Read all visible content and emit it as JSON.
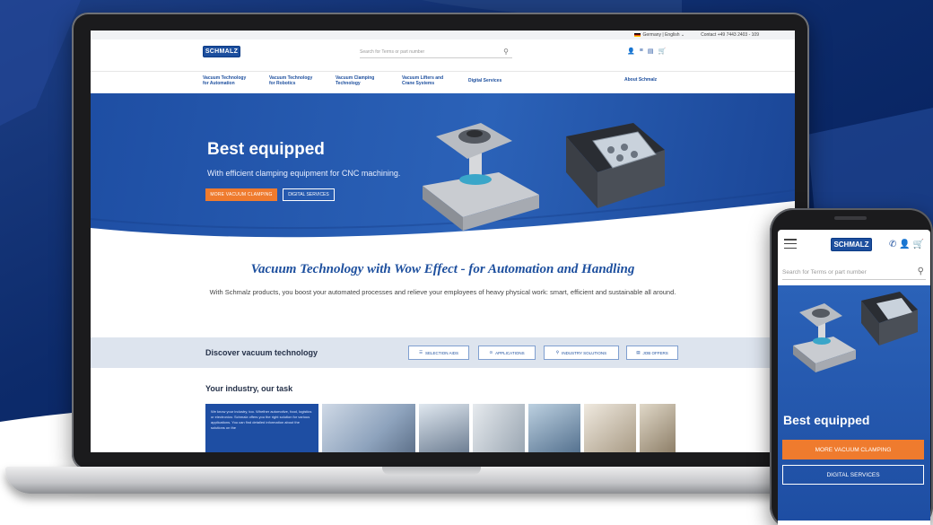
{
  "laptop": {
    "topbar": {
      "locale": "Germany | English",
      "contact": "Contact +49 7443 2403 - 109"
    },
    "header": {
      "logo": "SCHMALZ",
      "search_placeholder": "Search for Terms or part number"
    },
    "nav": [
      {
        "label": "Vacuum Technology for Automation"
      },
      {
        "label": "Vacuum Technology for Robotics"
      },
      {
        "label": "Vacuum Clamping Technology"
      },
      {
        "label": "Vacuum Lifters and Crane Systems"
      },
      {
        "label": "Digital Services"
      }
    ],
    "nav_about": "About Schmalz",
    "hero": {
      "title": "Best equipped",
      "subtitle": "With efficient clamping equipment for CNC machining.",
      "primary_button": "MORE VACUUM CLAMPING",
      "secondary_button": "DIGITAL SERVICES"
    },
    "section": {
      "title": "Vacuum Technology with Wow Effect - for Automation and Handling",
      "text": "With Schmalz products, you boost your automated processes and relieve your employees of heavy physical work: smart, efficient and sustainable all around."
    },
    "discover": {
      "label": "Discover vacuum technology",
      "buttons": [
        {
          "label": "SELECTION AIDS",
          "icon": "sliders-icon"
        },
        {
          "label": "APPLICATIONS",
          "icon": "play-circle-icon"
        },
        {
          "label": "INDUSTRY SOLUTIONS",
          "icon": "search-icon"
        },
        {
          "label": "JOB OFFERS",
          "icon": "document-icon"
        }
      ]
    },
    "industry": {
      "title": "Your industry, our task",
      "card_text": "We know your industry, too. Whether automotive, food, logistics or electronics: Schmalz offers you the right solution for various applications. You can find detailed information about the solutions on the"
    }
  },
  "phone": {
    "logo": "SCHMALZ",
    "search_placeholder": "Search for Terms or part number",
    "hero_title": "Best equipped",
    "primary_button": "MORE VACUUM CLAMPING",
    "secondary_button": "DIGITAL SERVICES"
  },
  "colors": {
    "brand_blue": "#1d4f9e",
    "accent_orange": "#ef7b2e",
    "background": "#0d2b6b"
  }
}
